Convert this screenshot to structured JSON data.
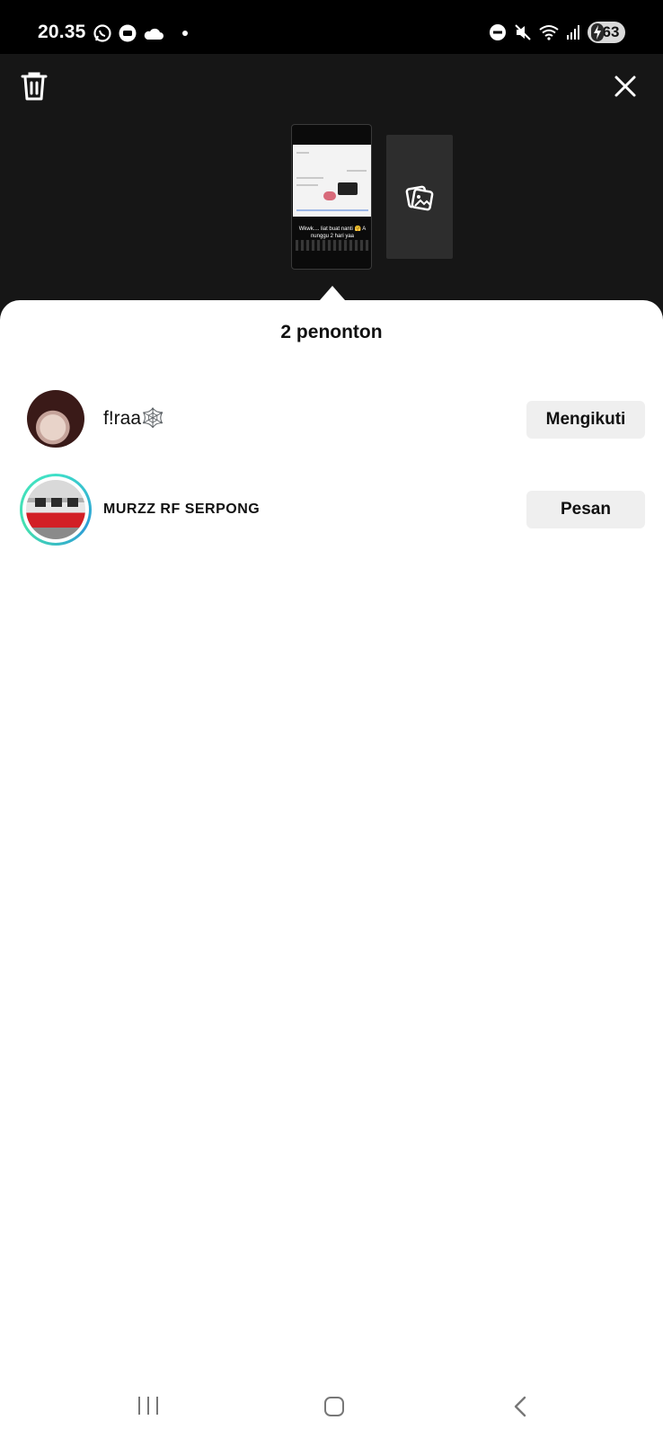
{
  "status_bar": {
    "time": "20.35",
    "left_icons": [
      "whatsapp-icon",
      "chat-bubble-icon",
      "cloud-icon",
      "dot-icon"
    ],
    "right_icons": [
      "do-not-disturb-icon",
      "mute-vibrate-icon",
      "wifi-icon",
      "signal-icon"
    ],
    "battery_level": "63",
    "battery_charging": true
  },
  "header": {
    "trash_icon": "trash-icon",
    "close_icon": "close-icon",
    "story_thumbnail_caption": "Wkwk.... liat buat nanti 🤗 A nunggu 2 hari yaa",
    "add_media_icon": "image-gallery-icon"
  },
  "sheet": {
    "title": "2 penonton",
    "viewers": [
      {
        "name": "f!raa🕸️",
        "action": "Mengikuti",
        "story_ring": false
      },
      {
        "name": "MURZZ RF SERPONG",
        "action": "Pesan",
        "story_ring": true
      }
    ]
  },
  "nav": {
    "recents_icon": "recents-icon",
    "home_icon": "home-icon",
    "back_icon": "back-icon"
  },
  "colors": {
    "header_bg": "#161616",
    "sheet_bg": "#ffffff",
    "button_bg": "#efefef",
    "story_ring": "#3fe0c8"
  }
}
